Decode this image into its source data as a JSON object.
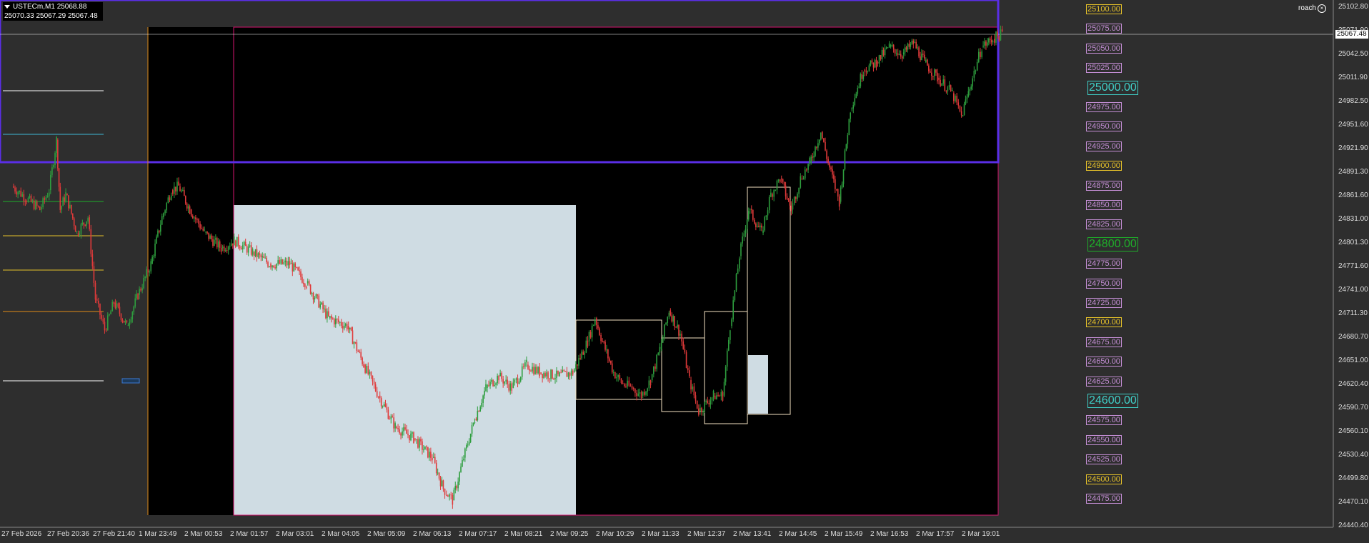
{
  "symbol": {
    "name": "USTECm,M1",
    "bid": "25068.88",
    "high": "25070.33",
    "low": "25067.29",
    "close": "25067.48"
  },
  "user_label": "roach",
  "current_price": "25067.48",
  "price_axis": [
    "25102.80",
    "25071.90",
    "25042.50",
    "25011.90",
    "24982.50",
    "24951.60",
    "24921.90",
    "24891.30",
    "24861.60",
    "24831.00",
    "24801.30",
    "24771.60",
    "24741.00",
    "24711.30",
    "24680.70",
    "24651.00",
    "24620.40",
    "24590.70",
    "24560.10",
    "24530.40",
    "24499.80",
    "24470.10",
    "24440.40"
  ],
  "time_axis": [
    "27 Feb 2026",
    "27 Feb 20:36",
    "27 Feb 21:40",
    "1 Mar 23:49",
    "2 Mar 00:53",
    "2 Mar 01:57",
    "2 Mar 03:01",
    "2 Mar 04:05",
    "2 Mar 05:09",
    "2 Mar 06:13",
    "2 Mar 07:17",
    "2 Mar 08:21",
    "2 Mar 09:25",
    "2 Mar 10:29",
    "2 Mar 11:33",
    "2 Mar 12:37",
    "2 Mar 13:41",
    "2 Mar 14:45",
    "2 Mar 15:49",
    "2 Mar 16:53",
    "2 Mar 17:57",
    "2 Mar 19:01"
  ],
  "level_tags": [
    {
      "text": "25100.00",
      "color": "#e6c229",
      "size": "small"
    },
    {
      "text": "25075.00",
      "color": "#c58fd6",
      "size": "small"
    },
    {
      "text": "25050.00",
      "color": "#c58fd6",
      "size": "small"
    },
    {
      "text": "25025.00",
      "color": "#c58fd6",
      "size": "small"
    },
    {
      "text": "25000.00",
      "color": "#3fd0c8",
      "size": "big"
    },
    {
      "text": "24975.00",
      "color": "#c58fd6",
      "size": "small"
    },
    {
      "text": "24950.00",
      "color": "#c58fd6",
      "size": "small"
    },
    {
      "text": "24925.00",
      "color": "#c58fd6",
      "size": "small"
    },
    {
      "text": "24900.00",
      "color": "#e6c229",
      "size": "small"
    },
    {
      "text": "24875.00",
      "color": "#c58fd6",
      "size": "small"
    },
    {
      "text": "24850.00",
      "color": "#c58fd6",
      "size": "small"
    },
    {
      "text": "24825.00",
      "color": "#c58fd6",
      "size": "small"
    },
    {
      "text": "24800.00",
      "color": "#1fae2a",
      "size": "big"
    },
    {
      "text": "24775.00",
      "color": "#c58fd6",
      "size": "small"
    },
    {
      "text": "24750.00",
      "color": "#c58fd6",
      "size": "small"
    },
    {
      "text": "24725.00",
      "color": "#c58fd6",
      "size": "small"
    },
    {
      "text": "24700.00",
      "color": "#e6c229",
      "size": "small"
    },
    {
      "text": "24675.00",
      "color": "#c58fd6",
      "size": "small"
    },
    {
      "text": "24650.00",
      "color": "#c58fd6",
      "size": "small"
    },
    {
      "text": "24625.00",
      "color": "#c58fd6",
      "size": "small"
    },
    {
      "text": "24600.00",
      "color": "#3fd0c8",
      "size": "big"
    },
    {
      "text": "24575.00",
      "color": "#c58fd6",
      "size": "small"
    },
    {
      "text": "24550.00",
      "color": "#c58fd6",
      "size": "small"
    },
    {
      "text": "24525.00",
      "color": "#c58fd6",
      "size": "small"
    },
    {
      "text": "24500.00",
      "color": "#e6c229",
      "size": "small"
    },
    {
      "text": "24475.00",
      "color": "#c58fd6",
      "size": "small"
    }
  ],
  "colors": {
    "background": "#2e2e2e",
    "chart_bg": "#000000",
    "bull_candle": "#2e9e3e",
    "bear_candle": "#e03a3a",
    "range_box": "#d6156f",
    "session_box": "#5a2ee6",
    "highlight_zone": "#cfdce3",
    "session_line": "#e38c17",
    "consolidation_box": "#f3e2c2"
  },
  "price_path": [
    [
      0.5,
      24870
    ],
    [
      2,
      24840
    ],
    [
      2.5,
      24865
    ],
    [
      2.9,
      24930
    ],
    [
      3.1,
      24840
    ],
    [
      3.4,
      24860
    ],
    [
      4.0,
      24810
    ],
    [
      4.6,
      24830
    ],
    [
      5,
      24725
    ],
    [
      5.5,
      24685
    ],
    [
      6,
      24720
    ],
    [
      6.7,
      24690
    ],
    [
      7.3,
      24730
    ],
    [
      8,
      24770
    ],
    [
      8.6,
      24830
    ],
    [
      9.1,
      24865
    ],
    [
      9.5,
      24870
    ],
    [
      10.1,
      24840
    ],
    [
      10.9,
      24810
    ],
    [
      11.8,
      24790
    ],
    [
      12.5,
      24800
    ],
    [
      13.5,
      24785
    ],
    [
      14.4,
      24770
    ],
    [
      15.5,
      24770
    ],
    [
      16.4,
      24745
    ],
    [
      17.6,
      24700
    ],
    [
      18.6,
      24690
    ],
    [
      19.5,
      24640
    ],
    [
      20.3,
      24600
    ],
    [
      21.2,
      24560
    ],
    [
      22.2,
      24545
    ],
    [
      23.2,
      24520
    ],
    [
      23.8,
      24480
    ],
    [
      24.3,
      24465
    ],
    [
      24.9,
      24520
    ],
    [
      25.5,
      24570
    ],
    [
      26.1,
      24610
    ],
    [
      26.8,
      24625
    ],
    [
      27.5,
      24610
    ],
    [
      28.3,
      24640
    ],
    [
      29,
      24630
    ],
    [
      30,
      24625
    ],
    [
      30.8,
      24630
    ],
    [
      31.6,
      24670
    ],
    [
      32,
      24700
    ],
    [
      32.4,
      24670
    ],
    [
      33,
      24630
    ],
    [
      33.5,
      24615
    ],
    [
      34,
      24610
    ],
    [
      34.5,
      24600
    ],
    [
      35,
      24620
    ],
    [
      35.5,
      24660
    ],
    [
      36,
      24710
    ],
    [
      36.6,
      24680
    ],
    [
      37.1,
      24620
    ],
    [
      37.6,
      24580
    ],
    [
      38.4,
      24600
    ],
    [
      38.9,
      24600
    ],
    [
      39.3,
      24690
    ],
    [
      39.8,
      24780
    ],
    [
      40.3,
      24840
    ],
    [
      41.0,
      24810
    ],
    [
      41.5,
      24860
    ],
    [
      42,
      24880
    ],
    [
      42.6,
      24840
    ],
    [
      43.1,
      24880
    ],
    [
      43.6,
      24900
    ],
    [
      44.2,
      24940
    ],
    [
      44.6,
      24900
    ],
    [
      45.2,
      24850
    ],
    [
      45.8,
      24970
    ],
    [
      46.5,
      25020
    ],
    [
      47.2,
      25030
    ],
    [
      47.9,
      25050
    ],
    [
      48.6,
      25040
    ],
    [
      49.2,
      25055
    ],
    [
      49.8,
      25030
    ],
    [
      50.5,
      25010
    ],
    [
      51.3,
      24990
    ],
    [
      51.8,
      24960
    ],
    [
      52.4,
      25010
    ],
    [
      52.9,
      25050
    ],
    [
      53.5,
      25060
    ],
    [
      54,
      25067
    ]
  ]
}
